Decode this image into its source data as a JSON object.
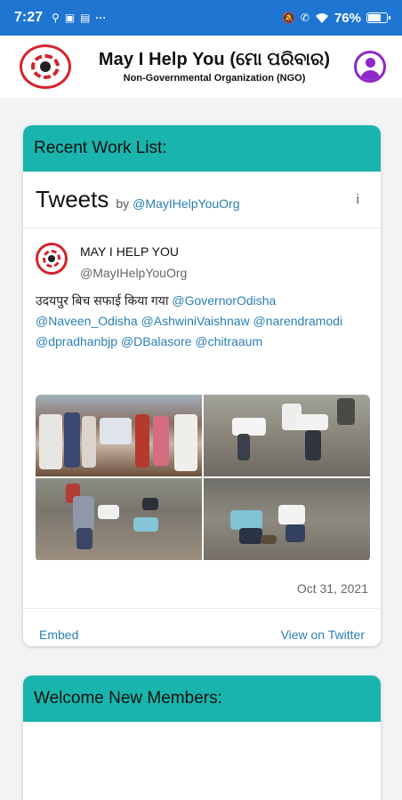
{
  "status_bar": {
    "time": "7:27",
    "left_icons": [
      "usb-icon",
      "nfc-icon",
      "notification-icon",
      "more-icon"
    ],
    "right_icons": [
      "silent-icon",
      "call-icon",
      "wifi-icon"
    ],
    "battery": "76%",
    "battery_level": 0.76
  },
  "header": {
    "title": "May I Help You (ମୋ ପରିବାର)",
    "subtitle": "Non-Governmental Organization (NGO)"
  },
  "recent_work": {
    "heading": "Recent Work List:",
    "widget": {
      "title": "Tweets",
      "by": "by",
      "handle": "@MayIHelpYouOrg",
      "info": "i",
      "tweet": {
        "author_name": "MAY I HELP YOU",
        "author_handle": "@MayIHelpYouOrg",
        "text_plain": "उदयपुर बिच सफाई किया गया ",
        "mentions": [
          "@GovernorOdisha",
          "@Naveen_Odisha",
          "@AshwiniVaishnaw",
          "@narendramodi",
          "@dpradhanbjp",
          "@DBalasore",
          "@chitraaum"
        ],
        "date": "Oct 31, 2021"
      },
      "embed_label": "Embed",
      "view_label": "View on Twitter"
    }
  },
  "welcome": {
    "heading": "Welcome New Members:"
  },
  "colors": {
    "status_bar": "#1f76d2",
    "accent_teal": "#19b5ad",
    "link_blue": "#2a7fb3",
    "profile_purple": "#8e28c8",
    "logo_red": "#d4232b"
  }
}
